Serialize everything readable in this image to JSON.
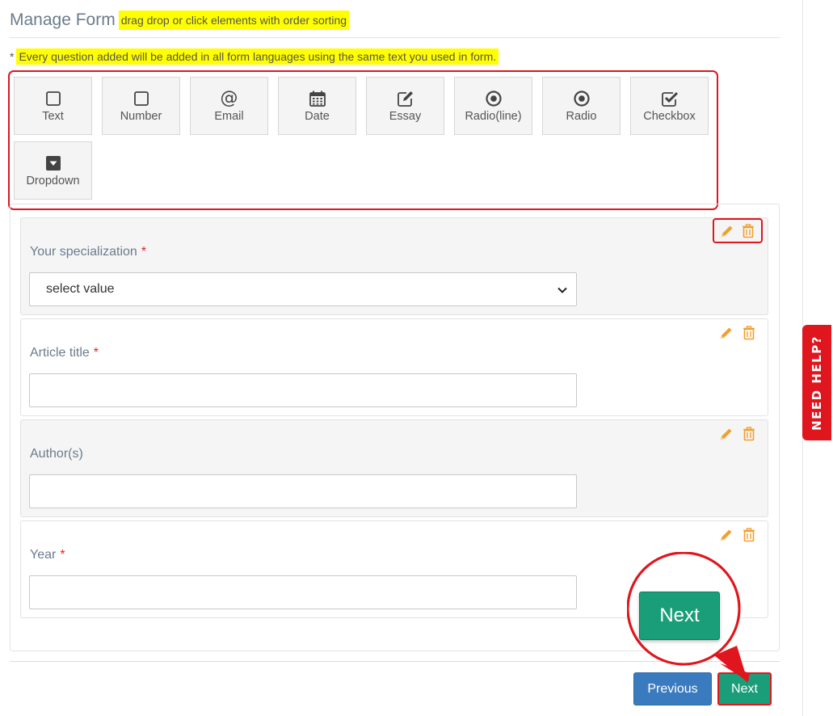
{
  "header": {
    "title": "Manage Form",
    "hint": "drag drop or click elements with order sorting"
  },
  "notice": {
    "prefix": "*",
    "text": "Every question added will be added in all form languages using the same text you used in form."
  },
  "palette": {
    "items": [
      {
        "label": "Text",
        "icon": "square-icon"
      },
      {
        "label": "Number",
        "icon": "square-icon"
      },
      {
        "label": "Email",
        "icon": "at-icon"
      },
      {
        "label": "Date",
        "icon": "calendar-icon"
      },
      {
        "label": "Essay",
        "icon": "edit-box-icon"
      },
      {
        "label": "Radio(line)",
        "icon": "radio-icon"
      },
      {
        "label": "Radio",
        "icon": "radio-icon"
      },
      {
        "label": "Checkbox",
        "icon": "checkbox-icon"
      },
      {
        "label": "Dropdown",
        "icon": "dropdown-icon"
      }
    ]
  },
  "questions": [
    {
      "label": "Your specialization",
      "required": "*",
      "type": "select",
      "value": "select value"
    },
    {
      "label": "Article title",
      "required": "*",
      "type": "text",
      "value": ""
    },
    {
      "label": "Author(s)",
      "required": "",
      "type": "text",
      "value": ""
    },
    {
      "label": "Year",
      "required": "*",
      "type": "text",
      "value": ""
    }
  ],
  "buttons": {
    "previous": "Previous",
    "next": "Next",
    "zoom_next": "Next"
  },
  "help": {
    "label": "NEED HELP?"
  },
  "colors": {
    "accent_green": "#1a9e79",
    "primary_blue": "#3a7bbf",
    "highlight": "#ffff00",
    "annotation_red": "#e0161e",
    "action_orange": "#f0a030"
  }
}
